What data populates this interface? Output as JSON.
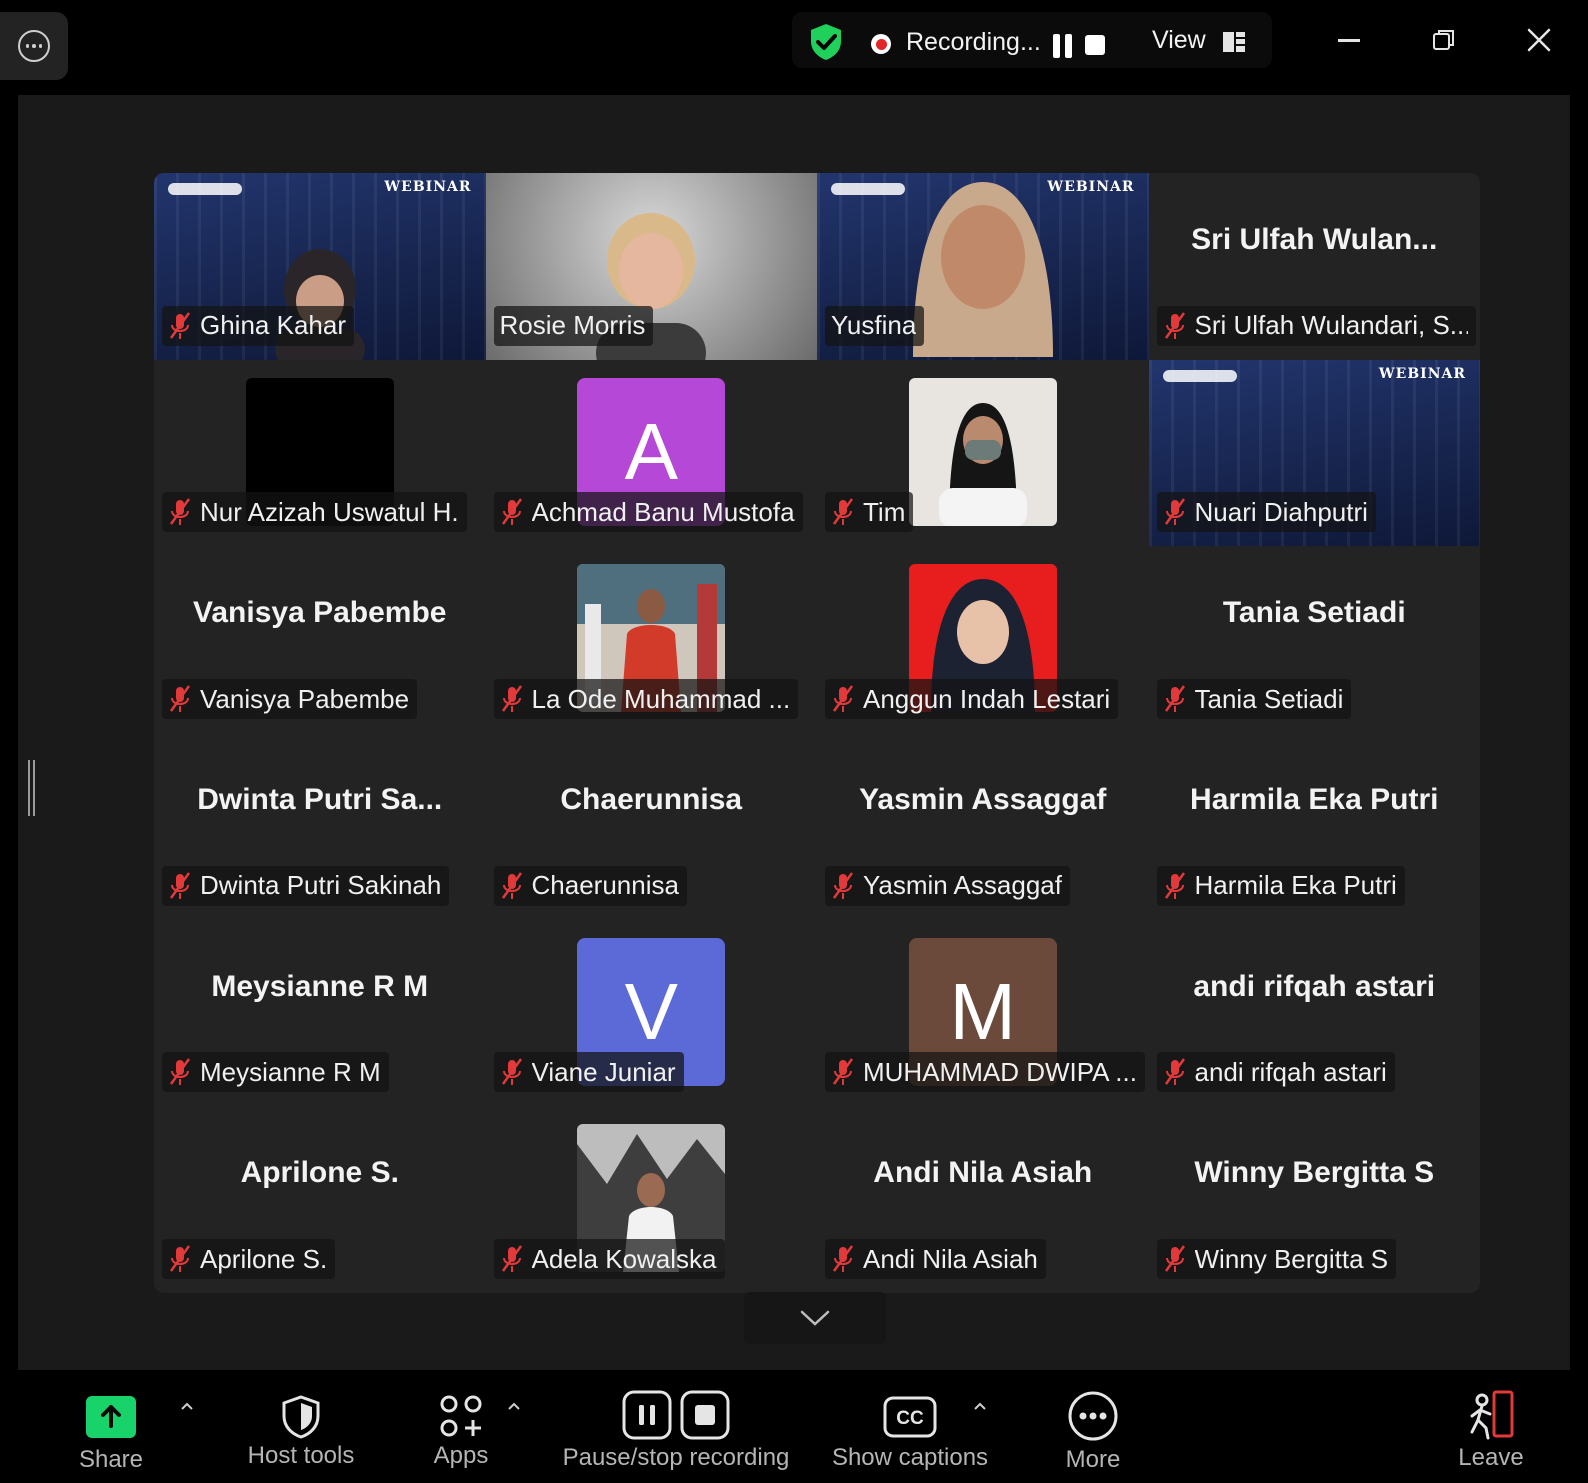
{
  "topbar": {
    "recording_label": "Recording...",
    "view_label": "View"
  },
  "colors": {
    "accent_green": "#23d959",
    "share_green": "#18d36a",
    "muted_red": "#e23a3a",
    "recording_red": "#e02626"
  },
  "participants": [
    {
      "label": "Ghina Kahar",
      "center_name": "",
      "tile_type": "webinar-video",
      "muted": true
    },
    {
      "label": "Rosie Morris",
      "center_name": "",
      "tile_type": "camera-video",
      "muted": false
    },
    {
      "label": "Yusfina",
      "center_name": "",
      "tile_type": "webinar-video",
      "muted": false,
      "active_speaker": true
    },
    {
      "label": "Sri Ulfah Wulandari, S...",
      "center_name": "Sri Ulfah Wulan...",
      "tile_type": "name-only",
      "muted": true
    },
    {
      "label": "Nur Azizah Uswatul H.",
      "center_name": "",
      "tile_type": "black-thumbnail",
      "muted": true
    },
    {
      "label": "Achmad Banu Mustofa",
      "center_name": "",
      "tile_type": "avatar-letter",
      "avatar_letter": "A",
      "avatar_color": "#b548d6",
      "muted": true
    },
    {
      "label": "Tim",
      "center_name": "",
      "tile_type": "photo-thumbnail",
      "muted": true
    },
    {
      "label": "Nuari Diahputri",
      "center_name": "",
      "tile_type": "webinar-video",
      "muted": true
    },
    {
      "label": "Vanisya Pabembe",
      "center_name": "Vanisya Pabembe",
      "tile_type": "name-only",
      "muted": true
    },
    {
      "label": "La Ode Muhammad ...",
      "center_name": "",
      "tile_type": "photo-thumbnail",
      "muted": true
    },
    {
      "label": "Anggun Indah Lestari",
      "center_name": "",
      "tile_type": "photo-thumbnail",
      "muted": true
    },
    {
      "label": "Tania Setiadi",
      "center_name": "Tania Setiadi",
      "tile_type": "name-only",
      "muted": true
    },
    {
      "label": "Dwinta Putri Sakinah",
      "center_name": "Dwinta Putri Sa...",
      "tile_type": "name-only",
      "muted": true
    },
    {
      "label": "Chaerunnisa",
      "center_name": "Chaerunnisa",
      "tile_type": "name-only",
      "muted": true
    },
    {
      "label": "Yasmin Assaggaf",
      "center_name": "Yasmin Assaggaf",
      "tile_type": "name-only",
      "muted": true
    },
    {
      "label": "Harmila Eka Putri",
      "center_name": "Harmila Eka Putri",
      "tile_type": "name-only",
      "muted": true
    },
    {
      "label": "Meysianne R M",
      "center_name": "Meysianne R M",
      "tile_type": "name-only",
      "muted": true
    },
    {
      "label": "Viane Juniar",
      "center_name": "",
      "tile_type": "avatar-letter",
      "avatar_letter": "V",
      "avatar_color": "#5b6ad6",
      "muted": true
    },
    {
      "label": "MUHAMMAD DWIPA ...",
      "center_name": "",
      "tile_type": "avatar-letter",
      "avatar_letter": "M",
      "avatar_color": "#6b4a3c",
      "muted": true
    },
    {
      "label": "andi rifqah astari",
      "center_name": "andi rifqah astari",
      "tile_type": "name-only",
      "muted": true
    },
    {
      "label": "Aprilone S.",
      "center_name": "Aprilone S.",
      "tile_type": "name-only",
      "muted": true
    },
    {
      "label": "Adela Kowalska",
      "center_name": "",
      "tile_type": "photo-thumbnail",
      "muted": true
    },
    {
      "label": "Andi Nila Asiah",
      "center_name": "Andi Nila Asiah",
      "tile_type": "name-only",
      "muted": true
    },
    {
      "label": "Winny Bergitta S",
      "center_name": "Winny Bergitta S",
      "tile_type": "name-only",
      "muted": true
    }
  ],
  "webinar_banner_text": "WEBINAR",
  "toolbar": {
    "share": "Share",
    "host_tools": "Host tools",
    "apps": "Apps",
    "pause_stop_recording": "Pause/stop recording",
    "show_captions": "Show captions",
    "more": "More",
    "leave": "Leave",
    "cc_icon_text": "CC"
  }
}
